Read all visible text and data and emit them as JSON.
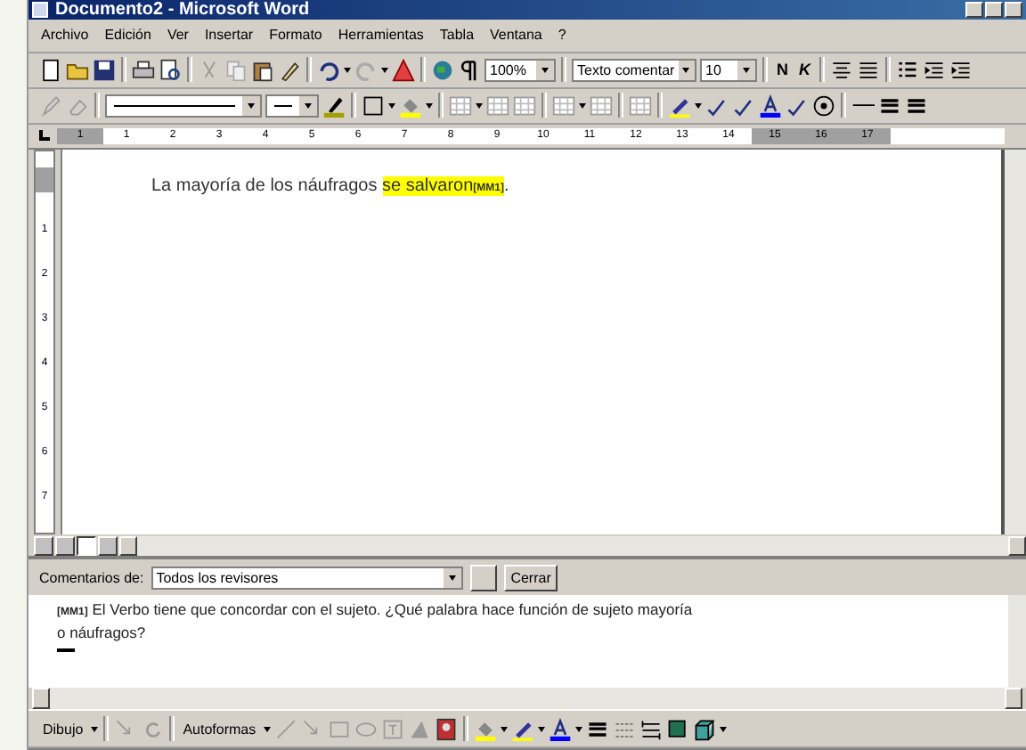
{
  "window": {
    "title": "Documento2 - Microsoft Word"
  },
  "menu": [
    "Archivo",
    "Edición",
    "Ver",
    "Insertar",
    "Formato",
    "Herramientas",
    "Tabla",
    "Ventana",
    "?"
  ],
  "toolbar": {
    "zoom": "100%",
    "style": "Texto comentar",
    "font_size": "10",
    "bold": "N",
    "italic": "K"
  },
  "ruler": {
    "labels": [
      "1",
      "1",
      "2",
      "3",
      "4",
      "5",
      "6",
      "7",
      "8",
      "9",
      "10",
      "11",
      "12",
      "13",
      "14",
      "15",
      "16",
      "17"
    ]
  },
  "vertical_ruler": {
    "labels": [
      "1",
      "2",
      "3",
      "4",
      "5",
      "6",
      "7"
    ]
  },
  "document": {
    "text_before": "La mayoría de los náufragos ",
    "highlighted": "se salvaron",
    "comment_mark": "[MM1]",
    "text_after": "."
  },
  "comments": {
    "label": "Comentarios de:",
    "reviewers": "Todos los revisores",
    "close": "Cerrar",
    "mark": "[MM1]",
    "text": "El Verbo tiene que concordar con el sujeto. ¿Qué palabra hace función de sujeto mayoría o náufragos?"
  },
  "drawing_toolbar": {
    "draw": "Dibujo",
    "autoshapes": "Autoformas"
  }
}
